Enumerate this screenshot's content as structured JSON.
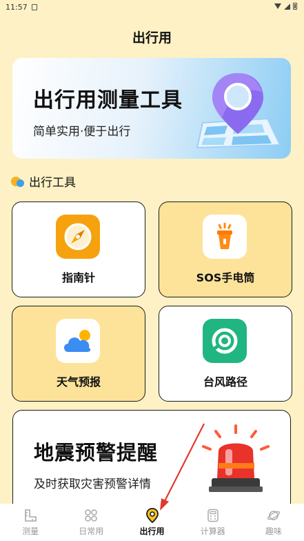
{
  "status_bar": {
    "time": "11:57"
  },
  "header": {
    "title": "出行用"
  },
  "banner": {
    "title": "出行用测量工具",
    "subtitle": "简单实用·便于出行",
    "icon": "map-pin-icon"
  },
  "section": {
    "label": "出行工具"
  },
  "tools": [
    {
      "label": "指南针",
      "icon": "compass-icon",
      "bg": "#ffffff"
    },
    {
      "label": "SOS手电筒",
      "icon": "flashlight-icon",
      "bg": "#fde39a"
    },
    {
      "label": "天气预报",
      "icon": "weather-icon",
      "bg": "#fde39a"
    },
    {
      "label": "台风路径",
      "icon": "typhoon-icon",
      "bg": "#ffffff"
    }
  ],
  "alert_card": {
    "title": "地震预警提醒",
    "subtitle": "及时获取灾害预警详情",
    "icon": "siren-icon"
  },
  "tabs": [
    {
      "label": "测量",
      "icon": "ruler-icon",
      "active": false
    },
    {
      "label": "日常用",
      "icon": "grid-icon",
      "active": false
    },
    {
      "label": "出行用",
      "icon": "location-icon",
      "active": true
    },
    {
      "label": "计算器",
      "icon": "calculator-icon",
      "active": false
    },
    {
      "label": "趣味",
      "icon": "planet-icon",
      "active": false
    }
  ],
  "colors": {
    "background": "#fdf1c5",
    "accent_yellow": "#fde39a",
    "arrow": "#e03a2f"
  }
}
